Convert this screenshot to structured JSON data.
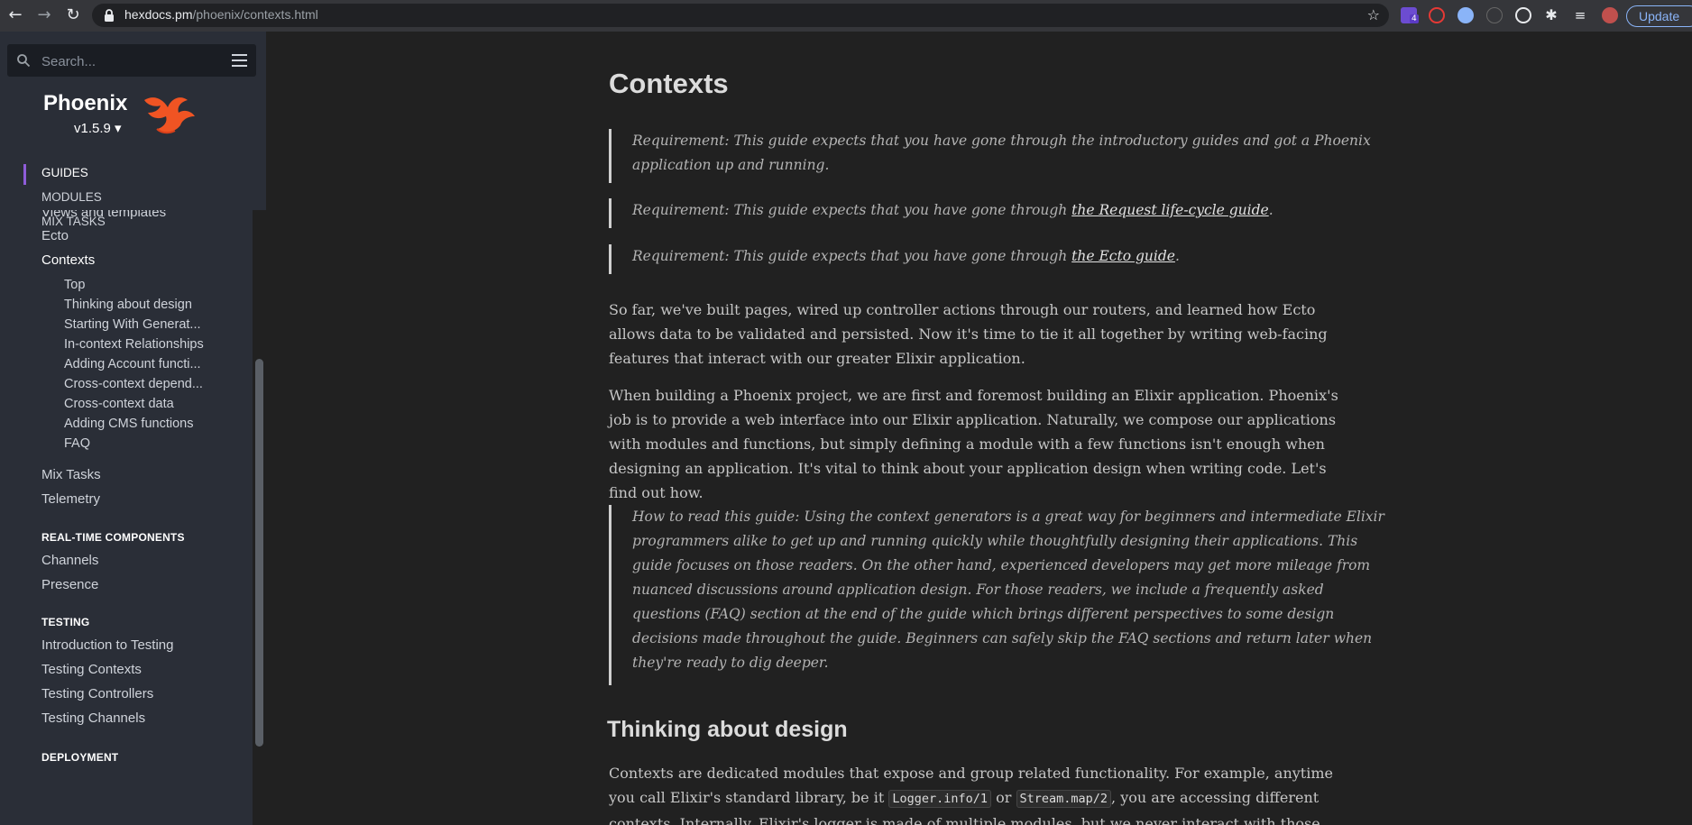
{
  "browser": {
    "url_domain": "hexdocs.pm",
    "url_path": "/phoenix/contexts.html",
    "update_label": "Update",
    "ext_badge": "4"
  },
  "sidebar": {
    "search_placeholder": "Search...",
    "project": "Phoenix",
    "version": "v1.5.9 ▾",
    "tabs": [
      "GUIDES",
      "MODULES",
      "MIX TASKS"
    ],
    "items": [
      "Views and templates",
      "Ecto",
      "Contexts"
    ],
    "sub_items": [
      "Top",
      "Thinking about design",
      "Starting With Generat...",
      "In-context Relationships",
      "Adding Account functi...",
      "Cross-context depend...",
      "Cross-context data",
      "Adding CMS functions",
      "FAQ"
    ],
    "more_items": [
      "Mix Tasks",
      "Telemetry"
    ],
    "group_realtime": "REAL-TIME COMPONENTS",
    "realtime_items": [
      "Channels",
      "Presence"
    ],
    "group_testing": "TESTING",
    "testing_items": [
      "Introduction to Testing",
      "Testing Contexts",
      "Testing Controllers",
      "Testing Channels"
    ],
    "group_deployment": "DEPLOYMENT"
  },
  "main": {
    "title": "Contexts",
    "req_prefix": "Requirement: This guide expects that you have gone through",
    "req1_line1": "Requirement: This guide expects that you have gone through the introductory guides and got a Phoenix",
    "req1_line2": "application up and running.",
    "req2_link": "the Request life-cycle guide",
    "req3_link": "the Ecto guide",
    "para1": "So far, we've built pages, wired up controller actions through our routers, and learned how Ecto allows data to be validated and persisted. Now it's time to tie it all together by writing web-facing features that interact with our greater Elixir application.",
    "para2": "When building a Phoenix project, we are first and foremost building an Elixir application. Phoenix's job is to provide a web interface into our Elixir application. Naturally, we compose our applications with modules and functions, but simply defining a module with a few functions isn't enough when designing an application. It's vital to think about your application design when writing code. Let's find out how.",
    "guide_note": "How to read this guide: Using the context generators is a great way for beginners and intermediate Elixir programmers alike to get up and running quickly while thoughtfully designing their applications. This guide focuses on those readers. On the other hand, experienced developers may get more mileage from nuanced discussions around application design. For those readers, we include a frequently asked questions (FAQ) section at the end of the guide which brings different perspectives to some design decisions made throughout the guide. Beginners can safely skip the FAQ sections and return later when they're ready to dig deeper.",
    "section_heading": "Thinking about design",
    "para3_a": "Contexts are dedicated modules that expose and group related functionality. For example, anytime you call Elixir's standard library, be it",
    "code1": "Logger.info/1",
    "para3_or": "or",
    "code2": "Stream.map/2",
    "para3_b": ", you are accessing different contexts. Internally, Elixir's logger is made of multiple modules, but we never interact with those modules directly."
  }
}
